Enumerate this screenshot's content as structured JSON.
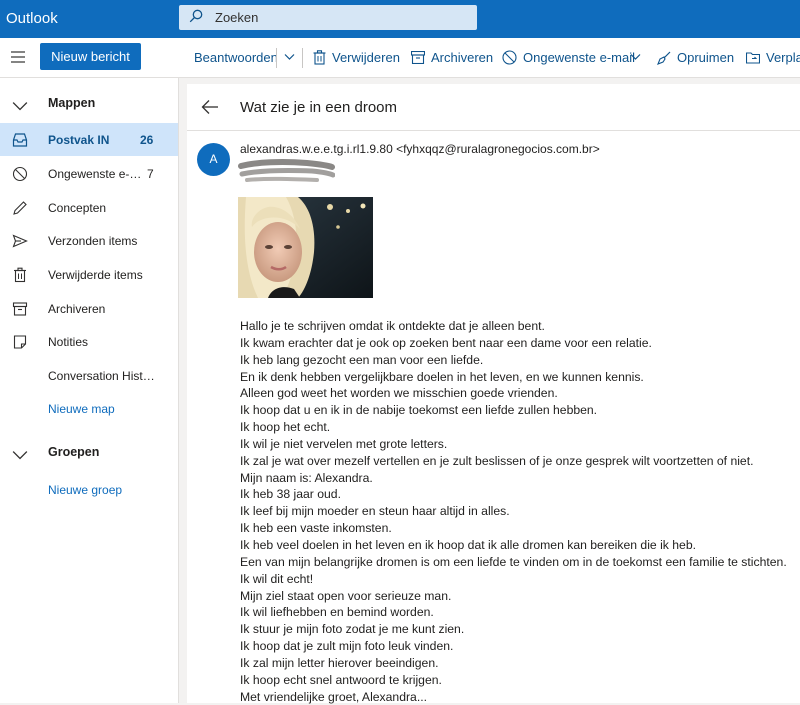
{
  "app": {
    "title": "Outlook"
  },
  "search": {
    "placeholder": "Zoeken"
  },
  "toolbar": {
    "new_message": "Nieuw bericht",
    "reply": "Beantwoorden",
    "delete": "Verwijderen",
    "archive": "Archiveren",
    "junk": "Ongewenste e-mail",
    "sweep": "Opruimen",
    "move": "Verpla"
  },
  "sidebar": {
    "folders_header": "Mappen",
    "items": [
      {
        "label": "Postvak IN",
        "count": "26",
        "icon": "inbox-icon"
      },
      {
        "label": "Ongewenste e-…",
        "count": "7",
        "icon": "junk-icon"
      },
      {
        "label": "Concepten",
        "count": "",
        "icon": "pencil-icon"
      },
      {
        "label": "Verzonden items",
        "count": "",
        "icon": "send-icon"
      },
      {
        "label": "Verwijderde items",
        "count": "",
        "icon": "trash-icon"
      },
      {
        "label": "Archiveren",
        "count": "",
        "icon": "archive-icon"
      },
      {
        "label": "Notities",
        "count": "",
        "icon": "note-icon"
      },
      {
        "label": "Conversation Hist…",
        "count": "",
        "icon": ""
      }
    ],
    "new_folder": "Nieuwe map",
    "groups_header": "Groepen",
    "new_group": "Nieuwe groep"
  },
  "message": {
    "subject": "Wat zie je in een droom",
    "avatar_initial": "A",
    "sender": "alexandras.w.e.e.tg.i.rl1.9.80 <fyhxqqz@ruralagronegocios.com.br>",
    "body": [
      "Hallo je te schrijven omdat ik ontdekte dat je alleen bent.",
      "Ik kwam erachter dat je ook op zoeken bent naar een dame voor een relatie.",
      "Ik heb lang gezocht een man voor een  liefde.",
      "En ik denk hebben vergelijkbare doelen in het leven, en we kunnen kennis.",
      "Alleen god weet het worden we misschien goede vrienden.",
      "Ik hoop dat u en ik in de nabije toekomst een liefde zullen hebben.",
      "Ik hoop het echt.",
      "Ik wil je niet vervelen met grote letters.",
      "Ik zal je wat over mezelf vertellen en je zult beslissen of je onze gesprek wilt voortzetten of niet.",
      "Mijn naam is: Alexandra.",
      "Ik heb 38 jaar oud.",
      "Ik leef bij mijn moeder en steun haar altijd in alles.",
      "Ik heb een vaste inkomsten.",
      "Ik heb veel doelen in het leven en ik hoop dat ik alle dromen kan bereiken die ik heb.",
      "Een van mijn belangrijke dromen is om een liefde te vinden om in de toekomst een familie te stichten.",
      "Ik wil dit echt!",
      "Mijn ziel staat open voor serieuze man.",
      "Ik wil liefhebben en bemind worden.",
      "Ik stuur je mijn foto zodat je me kunt zien.",
      "Ik hoop dat je zult mijn foto leuk vinden.",
      "Ik zal mijn letter hierover beeindigen.",
      "Ik hoop echt snel antwoord te krijgen.",
      "Met vriendelijke groet, Alexandra..."
    ]
  },
  "colors": {
    "brand": "#0f6cbd",
    "selected": "#cfe4fa",
    "link": "#0f548c"
  }
}
